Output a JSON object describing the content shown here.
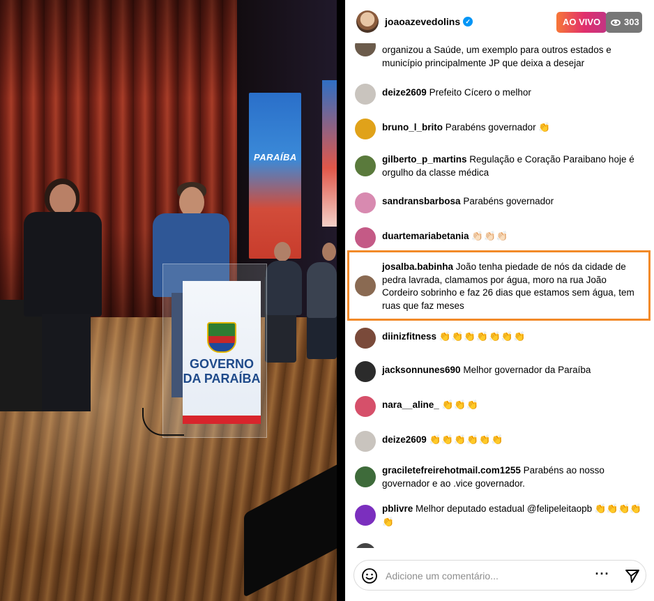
{
  "stream": {
    "banner_text": "PARAÍBA",
    "podium_line1": "GOVERNO",
    "podium_line2": "DA PARAÍBA"
  },
  "header": {
    "username": "joaoazevedolins",
    "verified_icon": "verified-badge-icon",
    "live_label": "AO VIVO",
    "viewer_count": "303",
    "viewer_icon": "eye-icon"
  },
  "comments": [
    {
      "user": "",
      "text": "organizou a Saúde, um exemplo para outros estados e município principalmente JP que deixa a desejar",
      "avatar_color": "#6b5b4b"
    },
    {
      "user": "deize2609",
      "text": "Prefeito Cícero o melhor",
      "avatar_color": "#c9c4be"
    },
    {
      "user": "bruno_l_brito",
      "text": "Parabéns governador 👏",
      "avatar_color": "#e0a21a"
    },
    {
      "user": "gilberto_p_martins",
      "text": "Regulação e Coração Paraibano hoje é orgulho da classe médica",
      "avatar_color": "#5a7a3c"
    },
    {
      "user": "sandransbarbosa",
      "text": "Parabéns governador",
      "avatar_color": "#d88ab0"
    },
    {
      "user": "duartemariabetania",
      "text": "👏🏻👏🏻👏🏻",
      "avatar_color": "#c45a86"
    },
    {
      "user": "josalba.babinha",
      "text": "João tenha piedade de nós da cidade de pedra lavrada, clamamos por água, moro na rua João Cordeiro sobrinho e faz 26 dias que estamos sem água, tem ruas que faz meses",
      "avatar_color": "#8a6a52"
    },
    {
      "user": "diinizfitness",
      "text": "👏👏👏👏👏👏👏",
      "avatar_color": "#7a4a3a"
    },
    {
      "user": "jacksonnunes690",
      "text": "Melhor governador da Paraíba",
      "avatar_color": "#2b2b2b"
    },
    {
      "user": "nara__aline_",
      "text": "👏👏👏",
      "avatar_color": "#d6506a"
    },
    {
      "user": "deize2609",
      "text": "👏👏👏👏👏👏",
      "avatar_color": "#c9c4be"
    },
    {
      "user": "graciletefreirehotmail.com1255",
      "text": "Parabéns ao nosso governador e ao .vice governador.",
      "avatar_color": "#3e6b3a"
    },
    {
      "user": "pblivre",
      "text": "Melhor deputado estadual @felipeleitaopb 👏👏👏👏👏",
      "avatar_color": "#7b2fbe"
    }
  ],
  "footer": {
    "placeholder": "Adicione um comentário...",
    "emoji_icon": "smiley-icon",
    "more_icon": "more-options-icon",
    "send_icon": "send-icon"
  },
  "colors": {
    "live_gradient_start": "#f77737",
    "live_gradient_end": "#c13584",
    "verified": "#0095f6",
    "highlight_border": "#f28a29"
  }
}
